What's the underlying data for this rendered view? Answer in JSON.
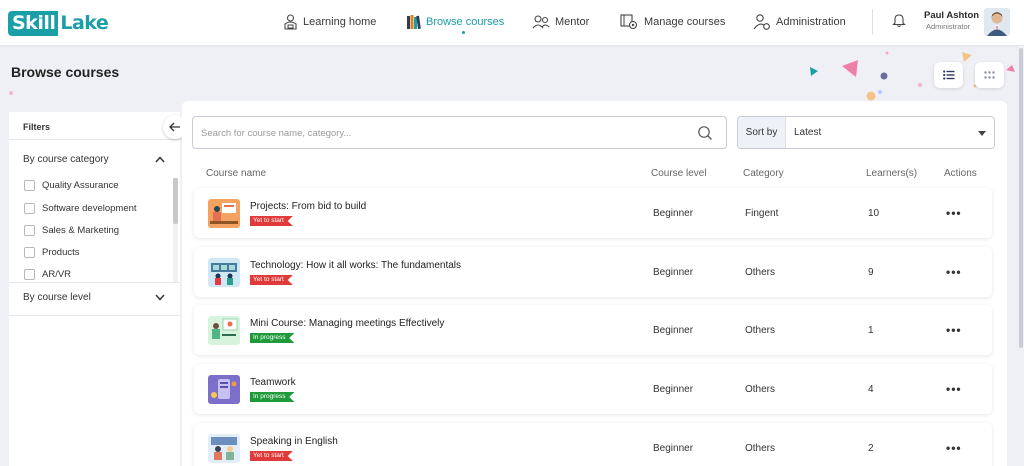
{
  "app": {
    "logo_part1": "Skill",
    "logo_part2": "Lake",
    "brand_color": "#1a9fa8"
  },
  "nav": {
    "items": [
      {
        "label": "Learning home",
        "icon": "learning-home-icon",
        "active": false
      },
      {
        "label": "Browse courses",
        "icon": "books-icon",
        "active": true
      },
      {
        "label": "Mentor",
        "icon": "mentor-icon",
        "active": false
      },
      {
        "label": "Manage courses",
        "icon": "manage-courses-icon",
        "active": false
      },
      {
        "label": "Administration",
        "icon": "administration-icon",
        "active": false
      }
    ]
  },
  "user": {
    "name": "Paul Ashton",
    "role": "Administrator"
  },
  "page": {
    "title": "Browse courses"
  },
  "filters": {
    "title": "Filters",
    "category_section": "By course category",
    "categories": [
      "Quality Assurance",
      "Software development",
      "Sales & Marketing",
      "Products",
      "AR/VR"
    ],
    "level_section": "By course level"
  },
  "search": {
    "placeholder": "Search for course name, category..."
  },
  "sort": {
    "label": "Sort by",
    "value": "Latest"
  },
  "table": {
    "headers": [
      "Course name",
      "Course level",
      "Category",
      "Learners(s)",
      "Actions"
    ],
    "rows": [
      {
        "name": "Projects: From bid to build",
        "status": "Yet to start",
        "level": "Beginner",
        "category": "Fingent",
        "learners": "10",
        "actions": "•••"
      },
      {
        "name": "Technology: How it all works: The fundamentals",
        "status": "Yet to start",
        "level": "Beginner",
        "category": "Others",
        "learners": "9",
        "actions": "•••"
      },
      {
        "name": "Mini Course: Managing meetings Effectively",
        "status": "In progress",
        "level": "Beginner",
        "category": "Others",
        "learners": "1",
        "actions": "•••"
      },
      {
        "name": "Teamwork",
        "status": "In progress",
        "level": "Beginner",
        "category": "Others",
        "learners": "4",
        "actions": "•••"
      },
      {
        "name": "Speaking in English",
        "status": "Yet to start",
        "level": "Beginner",
        "category": "Others",
        "learners": "2",
        "actions": "•••"
      }
    ]
  },
  "colors": {
    "status_yet_to_start": "#e03a3a",
    "status_in_progress": "#1e9a3a"
  }
}
